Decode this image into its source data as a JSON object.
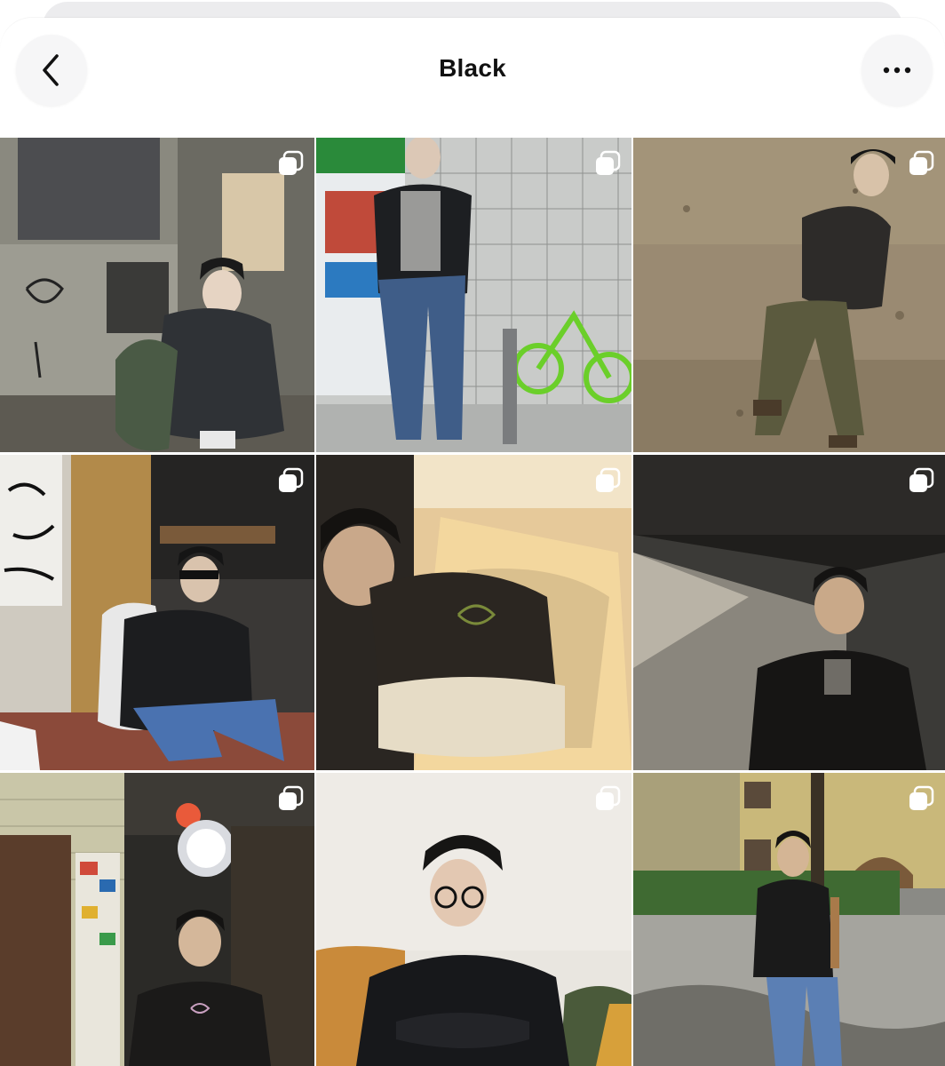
{
  "header": {
    "title": "Black"
  },
  "icons": {
    "back": "chevron-left-icon",
    "more": "more-horizontal-icon",
    "carousel": "multiple-photos-icon"
  },
  "grid": {
    "columns": 3,
    "posts": [
      {
        "index": 1,
        "carousel": true
      },
      {
        "index": 2,
        "carousel": true
      },
      {
        "index": 3,
        "carousel": true
      },
      {
        "index": 4,
        "carousel": true
      },
      {
        "index": 5,
        "carousel": true
      },
      {
        "index": 6,
        "carousel": true
      },
      {
        "index": 7,
        "carousel": true
      },
      {
        "index": 8,
        "carousel": true
      },
      {
        "index": 9,
        "carousel": true
      }
    ]
  }
}
